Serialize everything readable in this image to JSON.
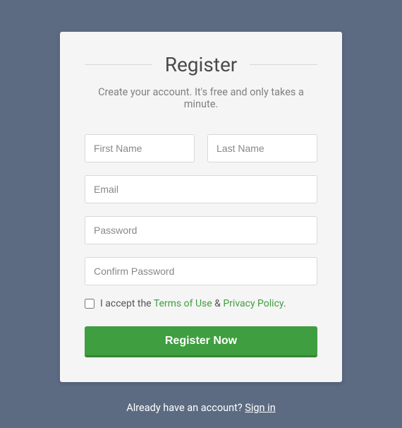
{
  "title": "Register",
  "subtitle": "Create your account. It's free and only takes a minute.",
  "fields": {
    "first_name": {
      "placeholder": "First Name",
      "value": ""
    },
    "last_name": {
      "placeholder": "Last Name",
      "value": ""
    },
    "email": {
      "placeholder": "Email",
      "value": ""
    },
    "password": {
      "placeholder": "Password",
      "value": ""
    },
    "confirm_password": {
      "placeholder": "Confirm Password",
      "value": ""
    }
  },
  "terms": {
    "prefix": "I accept the ",
    "tou_label": "Terms of Use",
    "separator": " & ",
    "privacy_label": "Privacy Policy",
    "suffix": "."
  },
  "submit_label": "Register Now",
  "footer": {
    "text": "Already have an account? ",
    "link": "Sign in"
  },
  "colors": {
    "background": "#5c6b82",
    "card": "#f5f5f5",
    "accent": "#3f9e3f"
  }
}
